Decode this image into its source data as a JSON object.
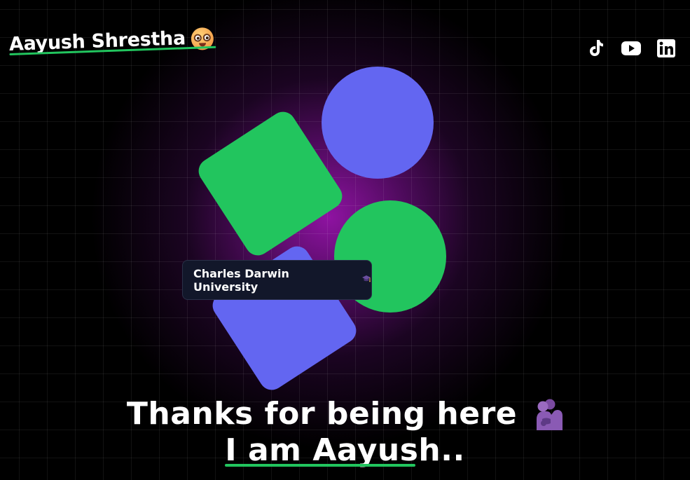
{
  "header": {
    "brand_name": "Aayush Shrestha",
    "brand_emoji": "nerd-face-emoji",
    "socials": [
      {
        "name": "tiktok-icon",
        "label": "TikTok"
      },
      {
        "name": "youtube-icon",
        "label": "YouTube"
      },
      {
        "name": "linkedin-icon",
        "label": "LinkedIn"
      }
    ]
  },
  "hero": {
    "badge_text": "Charles Darwin University",
    "badge_icon": "graduation-cap-icon",
    "headline_line1": "Thanks for being here",
    "headline_emoji": "people-hugging-emoji",
    "headline_line2": "I am Aayush.."
  },
  "colors": {
    "accent_green": "#22c55e",
    "accent_blue": "#6366f1",
    "glow_purple": "#9614aa",
    "background": "#000000"
  }
}
